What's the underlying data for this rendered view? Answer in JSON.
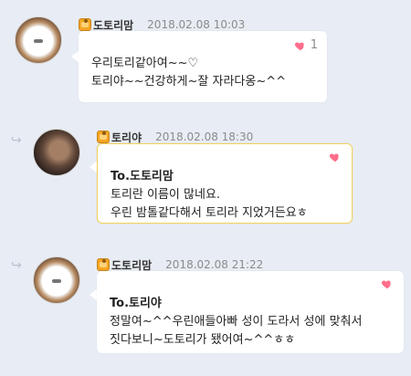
{
  "comments": [
    {
      "nickname": "도토리맘",
      "date": "2018.02.08 10:03",
      "lines": [
        "우리토리같아여~~♡",
        "토리야~~건강하게~잘 자라다옹~^^"
      ],
      "like_count": "1"
    },
    {
      "nickname": "토리야",
      "date": "2018.02.08 18:30",
      "to": "To.도토리맘",
      "lines": [
        "토리란 이름이 많네요.",
        "우린 밤톨같다해서 토리라 지었거든요ㅎ"
      ]
    },
    {
      "nickname": "도토리맘",
      "date": "2018.02.08 21:22",
      "to": "To.토리야",
      "lines": [
        "정말여~^^우린애들아빠 성이 도라서 성에 맞춰서",
        "짓다보니~도토리가 됐어여~^^ㅎㅎ"
      ]
    }
  ],
  "ui": {
    "reply_icon": "reply-arrow-icon",
    "like_icon": "heart-icon",
    "accent_colors": {
      "heart": "#ff6d8a",
      "highlight_border": "#f3d25b",
      "background": "#e8edf5"
    }
  }
}
